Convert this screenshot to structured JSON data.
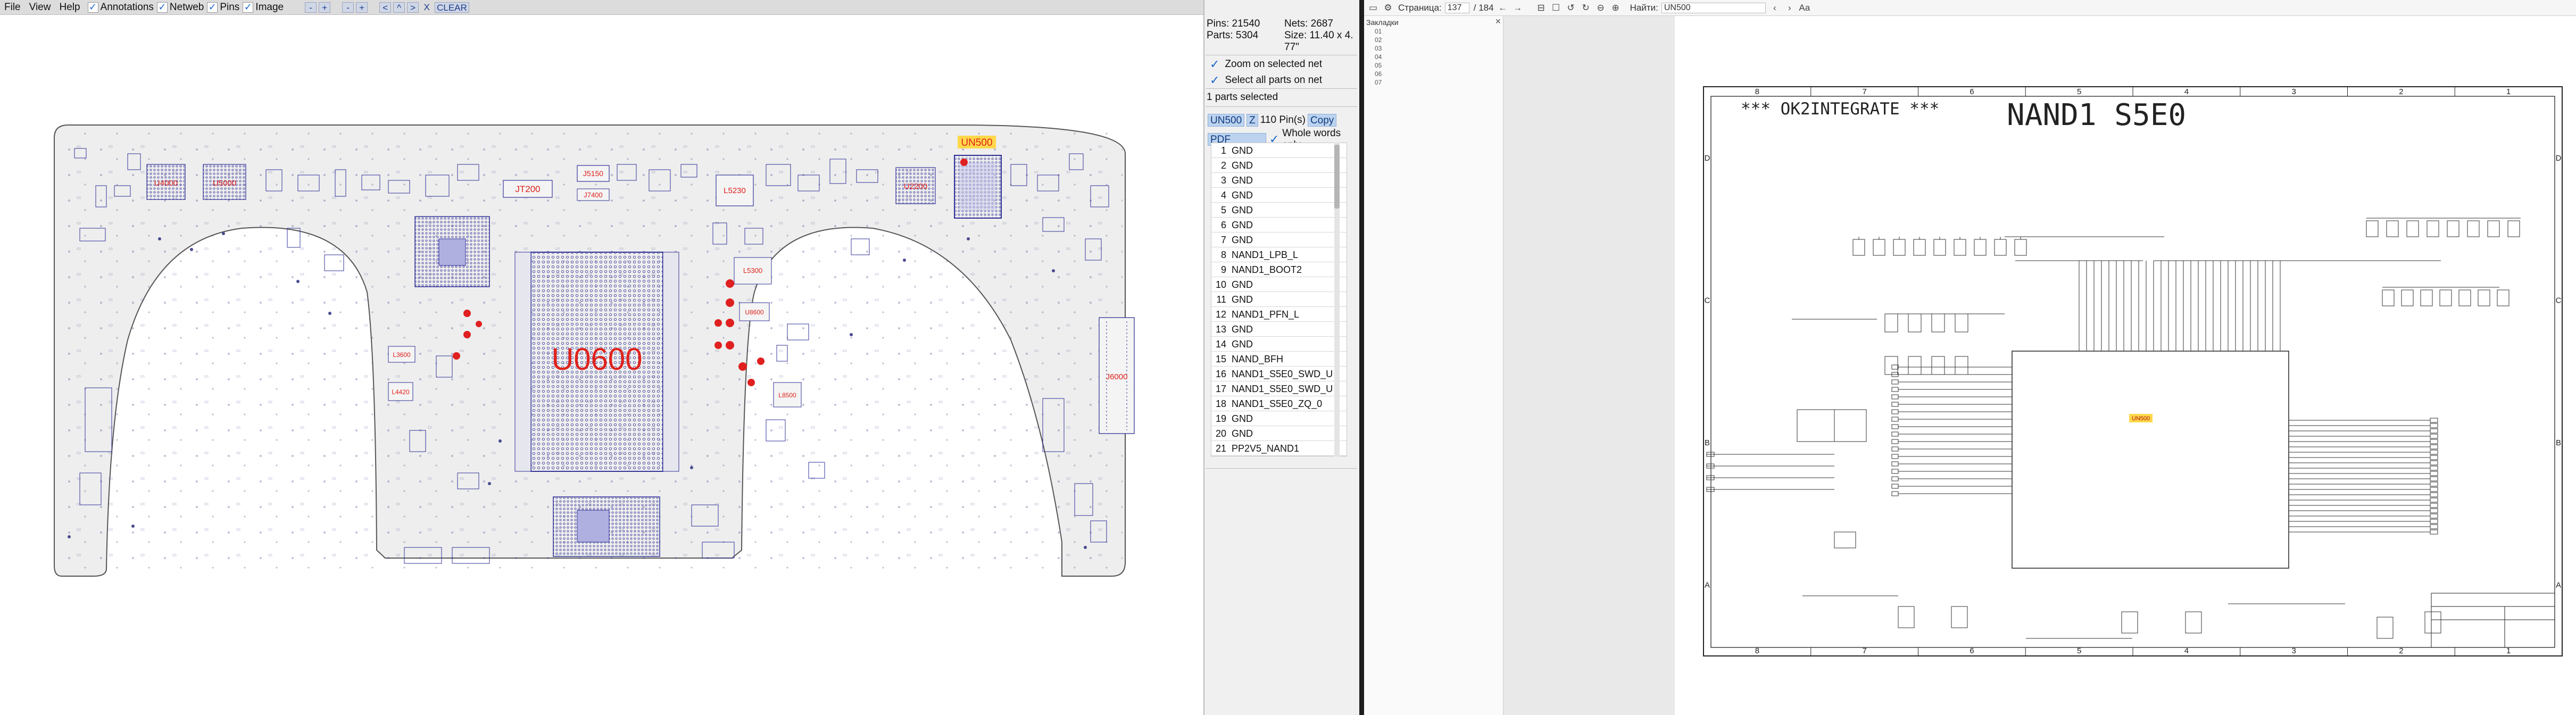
{
  "menubar": {
    "items": [
      "File",
      "View",
      "Help"
    ],
    "checks": [
      {
        "label": "Annotations",
        "checked": true
      },
      {
        "label": "Netweb",
        "checked": true
      },
      {
        "label": "Pins",
        "checked": true
      },
      {
        "label": "Image",
        "checked": true
      }
    ],
    "buttons": [
      "-",
      "+",
      "-",
      "+",
      "<",
      "^",
      ">",
      "X"
    ],
    "clear_label": "CLEAR"
  },
  "board": {
    "big_part": "U0600",
    "selected_part": "UN500",
    "labels": [
      "U4000",
      "U5000",
      "JT200",
      "J5150",
      "J7400",
      "L5230",
      "U2200",
      "U0600",
      "L5300",
      "UN500",
      "U8600",
      "L8500",
      "J6000",
      "L3600",
      "L4420"
    ]
  },
  "side_panel": {
    "pins_text": "Pins: 21540",
    "nets_text": "Nets: 2687",
    "parts_text": "Parts: 5304",
    "size_text": "Size: 11.40 x 4.",
    "size_text2": "77\"",
    "zoom_net_label": "Zoom on selected net",
    "select_all_label": "Select all parts on net",
    "parts_selected": "1 parts selected",
    "part_name": "UN500",
    "z_label": "Z",
    "pin_count": "110 Pin(s)",
    "copy_label": "Copy",
    "pdf_search_label": "PDF Search",
    "whole_words_label": "Whole words only",
    "pins": [
      {
        "n": "1",
        "net": "GND"
      },
      {
        "n": "2",
        "net": "GND"
      },
      {
        "n": "3",
        "net": "GND"
      },
      {
        "n": "4",
        "net": "GND"
      },
      {
        "n": "5",
        "net": "GND"
      },
      {
        "n": "6",
        "net": "GND"
      },
      {
        "n": "7",
        "net": "GND"
      },
      {
        "n": "8",
        "net": "NAND1_LPB_L"
      },
      {
        "n": "9",
        "net": "NAND1_BOOT2"
      },
      {
        "n": "10",
        "net": "GND"
      },
      {
        "n": "11",
        "net": "GND"
      },
      {
        "n": "12",
        "net": "NAND1_PFN_L"
      },
      {
        "n": "13",
        "net": "GND"
      },
      {
        "n": "14",
        "net": "GND"
      },
      {
        "n": "15",
        "net": "NAND_BFH"
      },
      {
        "n": "16",
        "net": "NAND1_S5E0_SWD_U"
      },
      {
        "n": "17",
        "net": "NAND1_S5E0_SWD_U"
      },
      {
        "n": "18",
        "net": "NAND1_S5E0_ZQ_0"
      },
      {
        "n": "19",
        "net": "GND"
      },
      {
        "n": "20",
        "net": "GND"
      },
      {
        "n": "21",
        "net": "PP2V5_NAND1"
      }
    ]
  },
  "pdf": {
    "page_label": "Страница:",
    "page_current": "137",
    "page_total": "/ 184",
    "find_label": "Найти:",
    "find_value": "UN500",
    "bookmarks_title": "Закладки",
    "bookmark_items": [
      "01",
      "02",
      "03",
      "04",
      "05",
      "06",
      "07"
    ],
    "schematic": {
      "header_left": "*** OK2INTEGRATE ***",
      "title": "NAND1 S5E0",
      "col_labels": [
        "8",
        "7",
        "6",
        "5",
        "4",
        "3",
        "2",
        "1"
      ],
      "row_labels": [
        "D",
        "C",
        "B",
        "A"
      ],
      "highlight": "UN500"
    }
  },
  "colors": {
    "board_fill": "#eeeeee",
    "board_outline": "#555555",
    "part_outline": "#333399",
    "label_red": "#e0221b",
    "highlight_yellow": "#ffd84a",
    "selected_blue": "#1a66cc"
  }
}
